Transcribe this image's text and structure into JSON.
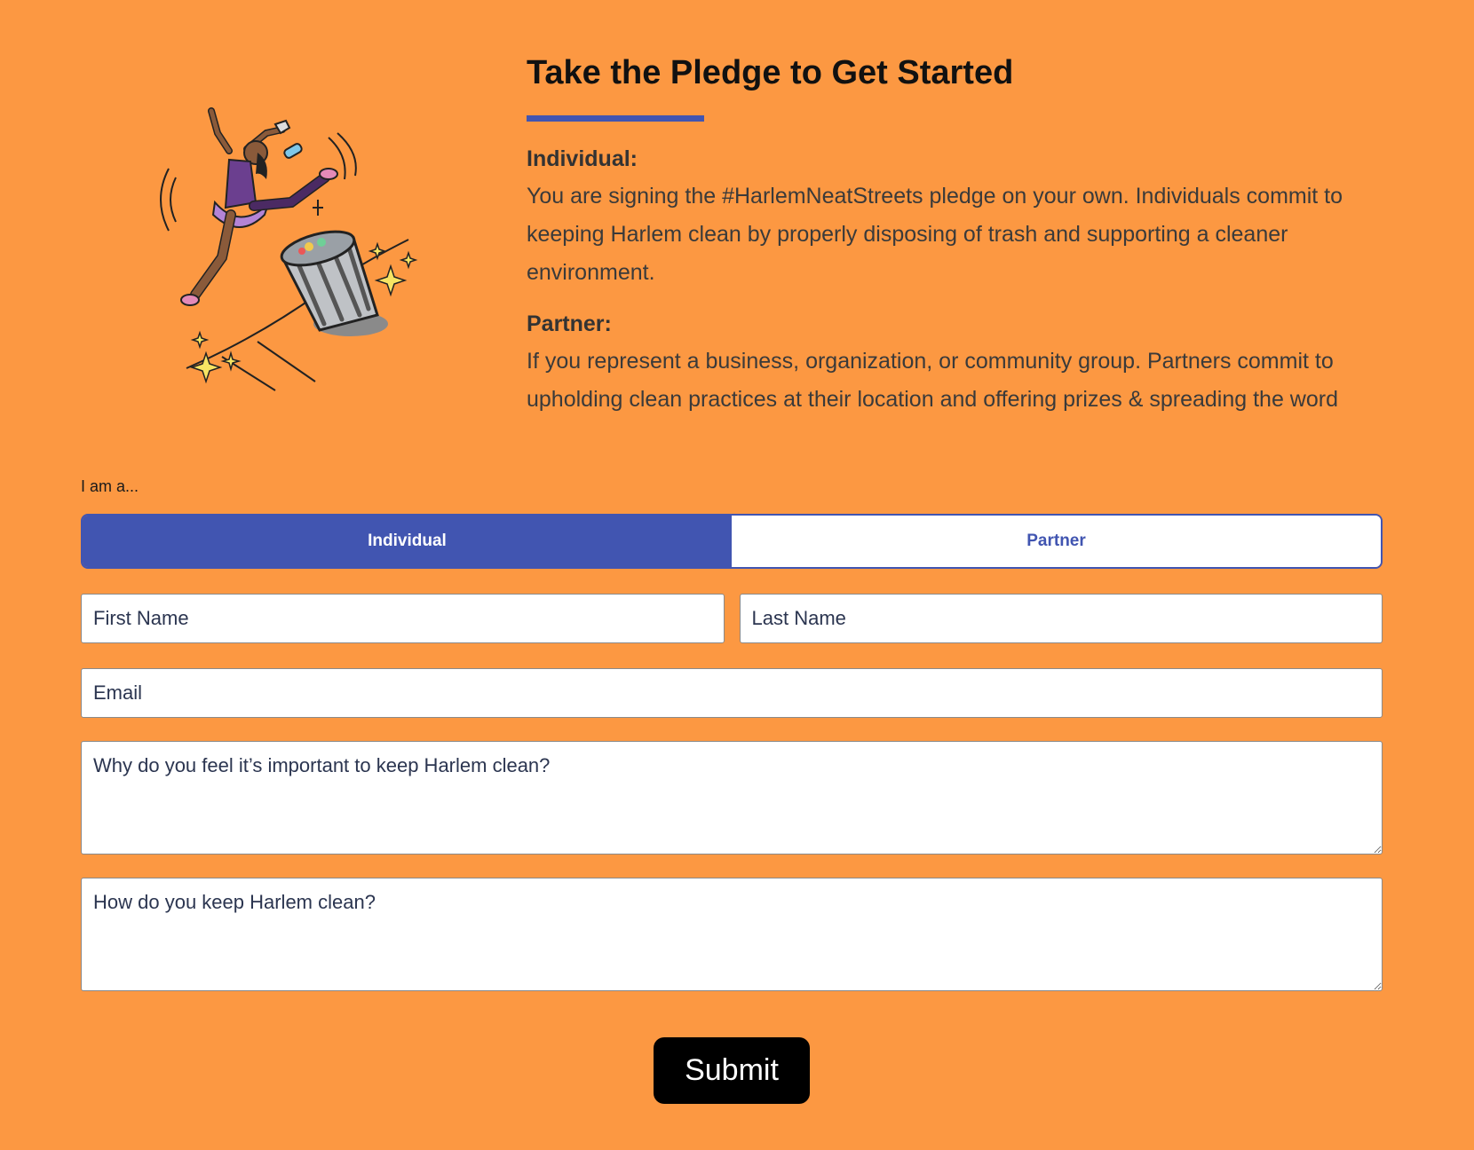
{
  "pledge": {
    "title": "Take the Pledge to Get Started",
    "individual": {
      "heading": "Individual:",
      "body": "You are signing the #HarlemNeatStreets pledge on your own. Individuals commit to keeping Harlem clean by properly disposing of trash and supporting a cleaner environment."
    },
    "partner": {
      "heading": "Partner:",
      "body": "If you represent a business, organization, or community group. Partners commit to upholding clean practices at their location and offering prizes & spreading the word"
    }
  },
  "form": {
    "role_label": "I am a...",
    "options": [
      "Individual",
      "Partner"
    ],
    "selected": "Individual",
    "first_name": {
      "placeholder": "First Name",
      "value": ""
    },
    "last_name": {
      "placeholder": "Last Name",
      "value": ""
    },
    "email": {
      "placeholder": "Email",
      "value": ""
    },
    "why_important": {
      "placeholder": "Why do you feel it’s important to keep Harlem clean?",
      "value": ""
    },
    "how_keep_clean": {
      "placeholder": "How do you keep Harlem clean?",
      "value": ""
    },
    "submit_label": "Submit"
  },
  "illustration": {
    "icon": "dancer-trash-can-illustration"
  },
  "colors": {
    "background": "#FC9842",
    "accent": "#4155B1",
    "submit_bg": "#000000"
  }
}
